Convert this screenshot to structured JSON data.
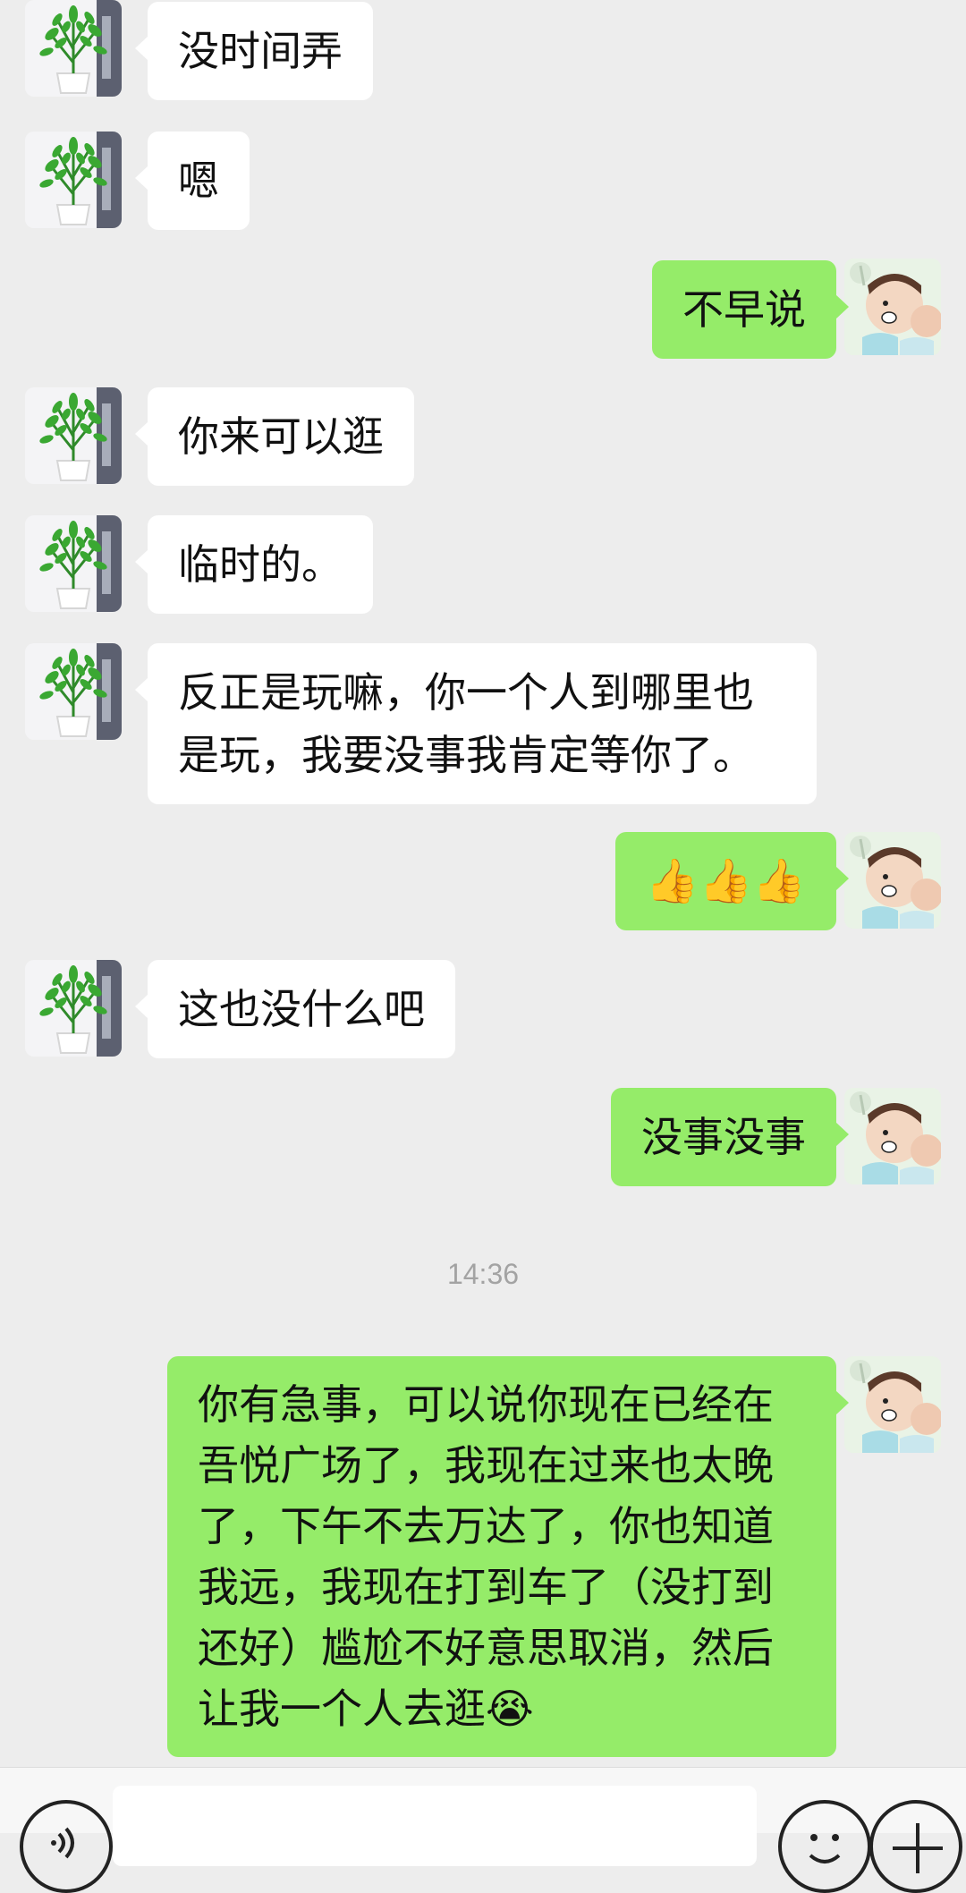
{
  "chat": {
    "messages": [
      {
        "side": "in",
        "text": "没时间弄"
      },
      {
        "side": "in",
        "text": "嗯"
      },
      {
        "side": "out",
        "text": "不早说"
      },
      {
        "side": "in",
        "text": "你来可以逛"
      },
      {
        "side": "in",
        "text": "临时的。"
      },
      {
        "side": "in",
        "text": "反正是玩嘛，你一个人到哪里也是玩，我要没事我肯定等你了。"
      },
      {
        "side": "out",
        "text": "👍👍👍"
      },
      {
        "side": "in",
        "text": "这也没什么吧"
      },
      {
        "side": "out",
        "text": "没事没事"
      },
      {
        "side": "out",
        "text": "你有急事，可以说你现在已经在吾悦广场了，我现在过来也太晚了，下午不去万达了，你也知道我远，我现在打到车了（没打到还好）尴尬不好意思取消，然后让我一个人去逛😭"
      }
    ],
    "timestamp": "14:36"
  },
  "avatars": {
    "contact": "potted-plant-avatar",
    "self": "cartoon-kid-avatar"
  },
  "input_bar": {
    "voice_icon": "voice-icon",
    "emoji_icon": "emoji-icon",
    "plus_icon": "plus-icon"
  },
  "colors": {
    "background": "#ededed",
    "incoming_bubble": "#ffffff",
    "outgoing_bubble": "#95ec69",
    "timestamp": "#a3a3a3"
  }
}
